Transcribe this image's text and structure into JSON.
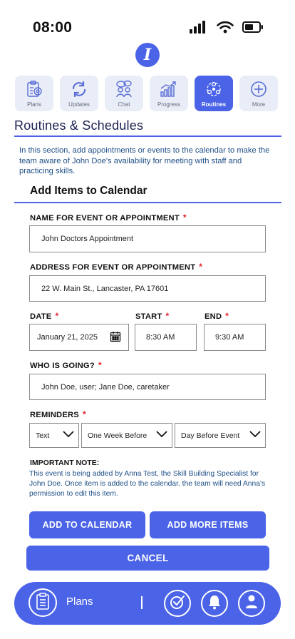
{
  "status_bar": {
    "time": "08:00"
  },
  "app_logo": {
    "letter": "I"
  },
  "tabs": [
    {
      "label": "Plans",
      "icon": "clipboard-target-icon",
      "active": false
    },
    {
      "label": "Updates",
      "icon": "refresh-icon",
      "active": false
    },
    {
      "label": "Chat",
      "icon": "chat-people-icon",
      "active": false
    },
    {
      "label": "Progress",
      "icon": "bar-chart-icon",
      "active": false
    },
    {
      "label": "Routines",
      "icon": "routine-cycle-icon",
      "active": true
    },
    {
      "label": "More",
      "icon": "plus-circle-icon",
      "active": false
    }
  ],
  "section": {
    "title": "Routines & Schedules",
    "intro": "In this section, add appointments or events to the calendar to make the team aware of John Doe's availability for meeting with staff and practicing skills."
  },
  "form": {
    "title": "Add Items to Calendar",
    "required_mark": "*",
    "name_label": "NAME FOR EVENT OR APPOINTMENT",
    "name_value": "John Doctors Appointment",
    "address_label": "ADDRESS FOR EVENT OR APPOINTMENT",
    "address_value": "22 W. Main St., Lancaster, PA 17601",
    "date_label": "DATE",
    "date_value": "January 21, 2025",
    "start_label": "START",
    "start_value": "8:30 AM",
    "end_label": "END",
    "end_value": "9:30 AM",
    "who_label": "WHO IS GOING?",
    "who_value": "John Doe, user;  Jane Doe, caretaker",
    "reminders_label": "REMINDERS",
    "reminder_type": "Text",
    "reminder_first": "One Week Before",
    "reminder_second": "Day Before Event",
    "note_title": "IMPORTANT NOTE:",
    "note_text": "This event is being added by Anna Test, the Skill Building Specialist for John Doe. Once item is added to the calendar, the team will need Anna's permission to edit this item."
  },
  "buttons": {
    "add_to_calendar": "ADD TO CALENDAR",
    "add_more_items": "ADD MORE ITEMS",
    "cancel": "CANCEL"
  },
  "bottom_nav": {
    "plans_label": "Plans",
    "icons": [
      "clipboard-list-icon",
      "check-circle-icon",
      "bell-icon",
      "user-icon"
    ]
  },
  "colors": {
    "accent": "#4a63e7",
    "tab_bg": "#e9edf7",
    "info_text": "#1e4f86",
    "required": "#e0202a"
  }
}
